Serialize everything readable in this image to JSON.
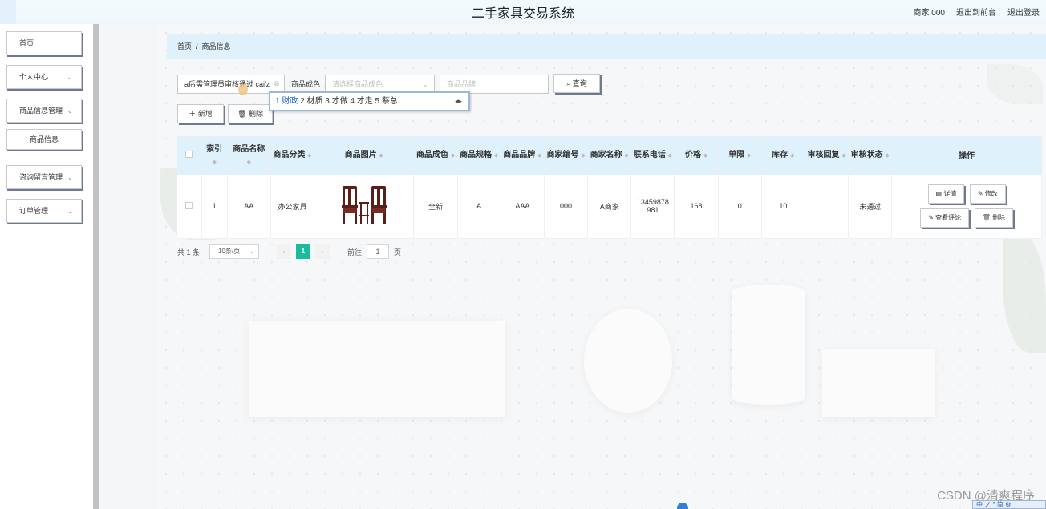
{
  "header": {
    "title": "二手家具交易系统",
    "user_label": "商家 000",
    "back_link": "退出到前台",
    "logout_link": "退出登录"
  },
  "sidebar": {
    "items": [
      {
        "label": "首页"
      },
      {
        "label": "个人中心"
      },
      {
        "label": "商品信息管理"
      },
      {
        "label": "商品信息"
      },
      {
        "label": "咨询留言管理"
      },
      {
        "label": "订单管理"
      }
    ]
  },
  "breadcrumb": {
    "home": "首页",
    "separator": "/",
    "current": "商品信息"
  },
  "search": {
    "name_value": "a后需管理员审核通过 cai'z",
    "color_label": "商品成色",
    "color_placeholder": "请选择商品成色",
    "brand_placeholder": "商品品牌",
    "query_label": "查询",
    "ime_candidates": [
      "1.财政",
      "2.材质",
      "3.才做",
      "4.才走",
      "5.蔡总"
    ]
  },
  "actions": {
    "add_label": "新增",
    "delete_label": "删除"
  },
  "table": {
    "headers": [
      "索引",
      "商品名称",
      "商品分类",
      "商品图片",
      "商品成色",
      "商品规格",
      "商品品牌",
      "商家编号",
      "商家名称",
      "联系电话",
      "价格",
      "单限",
      "库存",
      "审核回复",
      "审核状态",
      "操作"
    ],
    "rows": [
      {
        "index": "1",
        "name": "AA",
        "category": "办公家具",
        "color": "全新",
        "spec": "A",
        "brand": "AAA",
        "merchant_no": "000",
        "merchant_name": "A商家",
        "phone": "13459878981",
        "price": "168",
        "limit": "0",
        "stock": "10",
        "reply": "",
        "status": "未通过",
        "ops": {
          "detail": "详情",
          "edit": "修改",
          "review": "查看评论",
          "delete": "删除"
        }
      }
    ]
  },
  "pager": {
    "total": "共 1 条",
    "page_size": "10条/页",
    "current_page": "1",
    "goto_label": "前往",
    "goto_value": "1",
    "page_suffix": "页"
  },
  "watermark": "CSDN @清爽程序",
  "tray_text": "中 ノ ° 简 ⚙"
}
